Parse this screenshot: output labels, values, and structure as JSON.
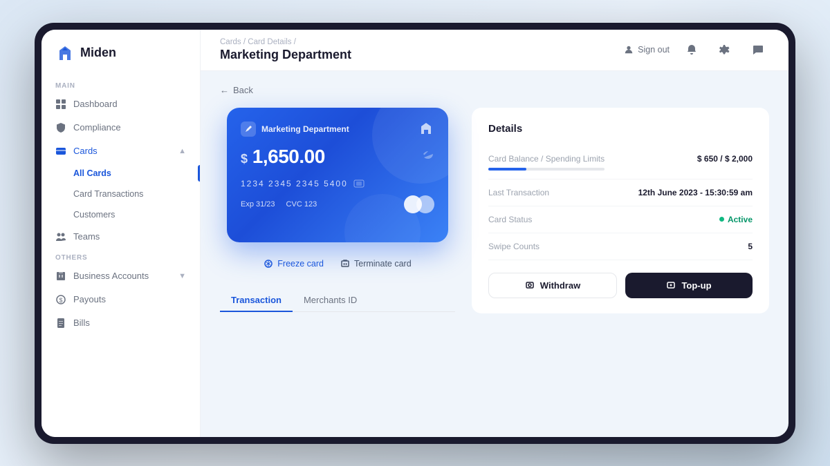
{
  "app": {
    "name": "Miden"
  },
  "topbar": {
    "breadcrumb": [
      "Cards",
      "Card Details"
    ],
    "page_title": "Marketing Department",
    "sign_out_label": "Sign out"
  },
  "back_button": "Back",
  "sidebar": {
    "section_main": "Main",
    "section_others": "Others",
    "items_main": [
      {
        "id": "dashboard",
        "label": "Dashboard",
        "icon": "grid"
      },
      {
        "id": "compliance",
        "label": "Compliance",
        "icon": "shield"
      },
      {
        "id": "cards",
        "label": "Cards",
        "icon": "card",
        "expanded": true,
        "chevron": "▲"
      }
    ],
    "subitems_cards": [
      {
        "id": "all-cards",
        "label": "All Cards",
        "active": true
      },
      {
        "id": "card-transactions",
        "label": "Card Transactions"
      },
      {
        "id": "customers",
        "label": "Customers"
      }
    ],
    "items_after": [
      {
        "id": "teams",
        "label": "Teams",
        "icon": "people"
      }
    ],
    "items_others": [
      {
        "id": "business-accounts",
        "label": "Business Accounts",
        "icon": "building",
        "chevron": "▼"
      },
      {
        "id": "payouts",
        "label": "Payouts",
        "icon": "coin"
      },
      {
        "id": "bills",
        "label": "Bills",
        "icon": "doc"
      }
    ]
  },
  "card": {
    "dept_name": "Marketing Department",
    "balance": "$ 1,650.00",
    "card_number": "1234 2345 2345 5400",
    "exp": "Exp  31/23",
    "cvc": "CVC  123"
  },
  "card_actions": {
    "freeze": "Freeze card",
    "terminate": "Terminate card"
  },
  "details": {
    "title": "Details",
    "rows": [
      {
        "label": "Card Balance / Spending Limits",
        "value": "$ 650  /  $ 2,000",
        "has_bar": true,
        "bar_pct": 32.5
      },
      {
        "label": "Last Transaction",
        "value": "12th June 2023 - 15:30:59 am"
      },
      {
        "label": "Card Status",
        "value": "Active",
        "is_status": true
      },
      {
        "label": "Swipe Counts",
        "value": "5"
      }
    ],
    "withdraw_label": "Withdraw",
    "topup_label": "Top-up"
  },
  "tabs": [
    {
      "id": "transaction",
      "label": "Transaction",
      "active": true
    },
    {
      "id": "merchants-id",
      "label": "Merchants ID"
    }
  ]
}
